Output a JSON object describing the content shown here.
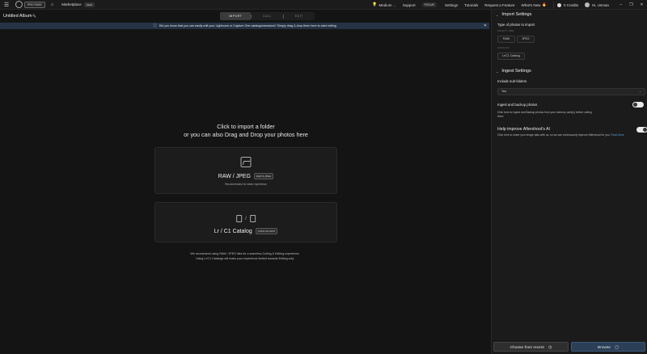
{
  "topbar": {
    "pro_badge": "PRO PASS",
    "marketplace": "Marketplace",
    "new_badge": "NEW",
    "medium_label": "Medium",
    "support": "Support",
    "focus_badge": "FOCUS",
    "settings": "Settings",
    "tutorials": "Tutorials",
    "request_feature": "Request a Feature",
    "whats_new": "What's New",
    "credits": "0 Credits",
    "greeting": "Hi, Usman"
  },
  "album": {
    "title": "Untitled Album"
  },
  "steps": [
    "IMPORT",
    "CULL",
    "EDIT"
  ],
  "banner": {
    "text": "Did you know that you can easily edit your Lightroom or Capture One catalogs/sessions? Simply drag & drop them here to start editing"
  },
  "dropzone": {
    "line1": "Click to import a folder",
    "line2": "or you can also Drag and Drop your photos here",
    "card1": {
      "heading": "RAW / JPEG",
      "badge": "RAW & JPEG",
      "sub": "Recommended for faster experience"
    },
    "card2": {
      "heading": "Lr / C1 Catalog",
      "badge": "CATALOG EDIT"
    },
    "recommend_1": "We recommend using RAW / JPEG files for a seamless Culling & Editing experience.",
    "recommend_2": "Using Lr/C1 Catalogs will make your experience limited towards Editing only."
  },
  "panel": {
    "import_settings": "Import Settings",
    "type_label": "Type of photos to import",
    "select_hint": "SELECT ONE",
    "raw": "RAW",
    "jpeg": "JPEG",
    "catalog_hint": "CATALOG",
    "catalog_option": "Lr/C1 Catalog",
    "ingest_settings": "Ingest Settings",
    "include_sub": "Include sub-folders",
    "yes": "Yes",
    "ingest_backup": "Ingest and backup photos",
    "ingest_desc": "Click here to ingest and Backup photos from your memory card(s) before culling them.",
    "help_improve": "Help improve Aftershoot's AI",
    "help_desc": "Click here to share your image data with us, so we can continuously improve Aftershoot for you.",
    "read_more": "Read More"
  },
  "buttons": {
    "choose_recent": "Choose from recent",
    "browse": "Browse"
  }
}
